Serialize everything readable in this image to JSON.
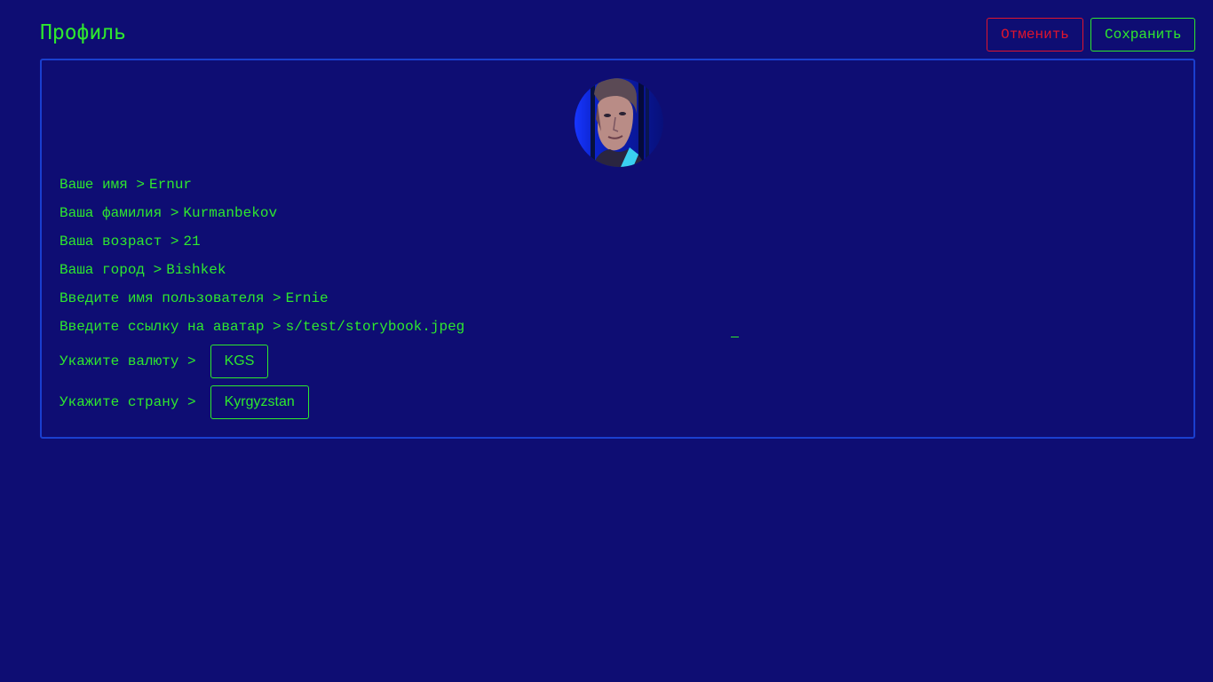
{
  "header": {
    "title": "Профиль",
    "cancel_label": "Отменить",
    "save_label": "Сохранить"
  },
  "colors": {
    "background": "#0e0d73",
    "text": "#2ee82e",
    "cancel": "#e0152d",
    "card_border": "#1a3fcf"
  },
  "profile": {
    "avatar_icon": "user-avatar-photo",
    "first_name": {
      "label": "Ваше имя >",
      "value": "Ernur"
    },
    "last_name": {
      "label": "Ваша фамилия >",
      "value": "Kurmanbekov"
    },
    "age": {
      "label": "Ваша возраст >",
      "value": "21"
    },
    "city": {
      "label": "Ваша город >",
      "value": "Bishkek"
    },
    "username": {
      "label": "Введите имя пользователя >",
      "value": "Ernie"
    },
    "avatar_url": {
      "label": "Введите ссылку на аватар >",
      "value": "s/test/storybook.jpeg"
    },
    "currency": {
      "label": "Укажите валюту >",
      "value": "KGS"
    },
    "country": {
      "label": "Укажите страну >",
      "value": "Kyrgyzstan"
    }
  }
}
